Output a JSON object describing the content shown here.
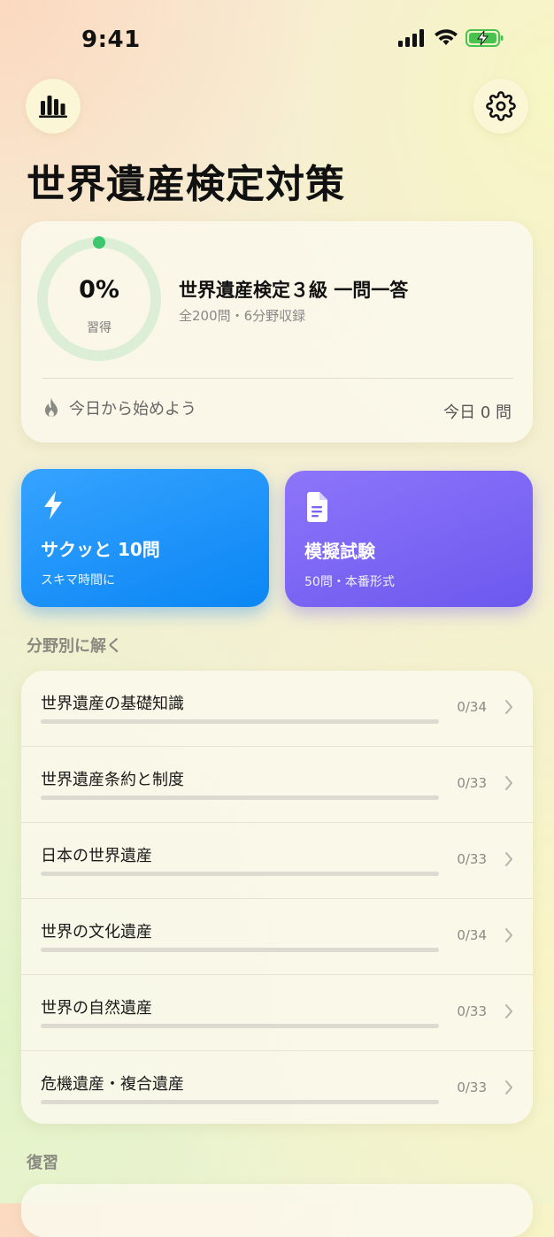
{
  "status": {
    "time": "9:41"
  },
  "header": {
    "title": "世界遺産検定対策"
  },
  "progress_card": {
    "percent": "0%",
    "percent_sub": "習得",
    "progress_fraction": 0,
    "title": "世界遺産検定３級 一問一答",
    "subtitle": "全200問・6分野収録",
    "streak_text": "今日から始めよう",
    "today_count": "今日 0 問"
  },
  "actions": {
    "quick": {
      "title": "サクッと 10問",
      "subtitle": "スキマ時間に"
    },
    "exam": {
      "title": "模擬試験",
      "subtitle": "50問・本番形式"
    }
  },
  "categories": {
    "header": "分野別に解く",
    "items": [
      {
        "label": "世界遺産の基礎知識",
        "count": "0/34",
        "progress": 0
      },
      {
        "label": "世界遺産条約と制度",
        "count": "0/33",
        "progress": 0
      },
      {
        "label": "日本の世界遺産",
        "count": "0/33",
        "progress": 0
      },
      {
        "label": "世界の文化遺産",
        "count": "0/34",
        "progress": 0
      },
      {
        "label": "世界の自然遺産",
        "count": "0/33",
        "progress": 0
      },
      {
        "label": "危機遺産・複合遺産",
        "count": "0/33",
        "progress": 0
      }
    ]
  },
  "review": {
    "header": "復習"
  },
  "colors": {
    "accent_green": "#3cc66e",
    "quick_blue": "#0a86f4",
    "exam_purple": "#6c58ee"
  },
  "icons": {
    "stats": "bar-chart-icon",
    "settings": "gear-icon",
    "streak": "flame-icon",
    "quick": "lightning-icon",
    "exam": "document-icon"
  }
}
